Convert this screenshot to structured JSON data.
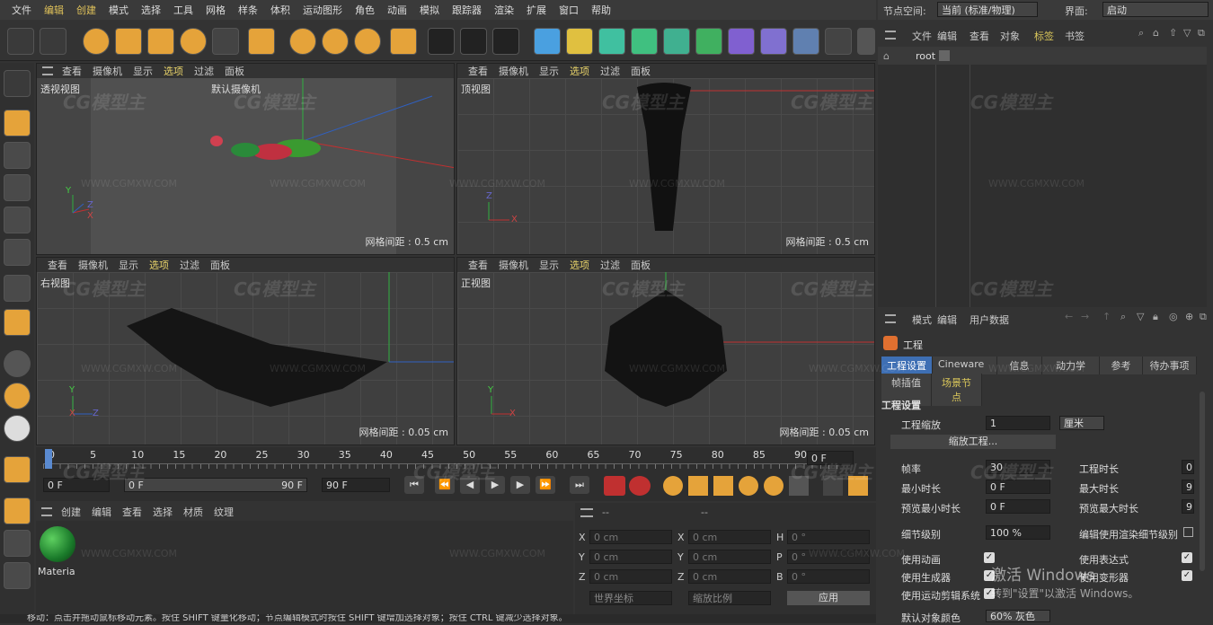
{
  "menubar": {
    "items": [
      "文件",
      "编辑",
      "创建",
      "模式",
      "选择",
      "工具",
      "网格",
      "样条",
      "体积",
      "运动图形",
      "角色",
      "动画",
      "模拟",
      "跟踪器",
      "渲染",
      "扩展",
      "窗口",
      "帮助"
    ]
  },
  "right_header": {
    "node_space_label": "节点空间:",
    "node_space_value": "当前 (标准/物理)",
    "interface_label": "界面:",
    "interface_value": "启动"
  },
  "viewport_menu": [
    "查看",
    "摄像机",
    "显示",
    "选项",
    "过滤",
    "面板"
  ],
  "viewports": {
    "perspective": {
      "name": "透视视图",
      "camera": "默认摄像机",
      "grid": "网格间距 : 0.5 cm"
    },
    "top": {
      "name": "顶视图",
      "grid": "网格间距 : 0.5 cm"
    },
    "right": {
      "name": "右视图",
      "grid": "网格间距 : 0.05 cm"
    },
    "front": {
      "name": "正视图",
      "grid": "网格间距 : 0.05 cm"
    }
  },
  "axes": {
    "x": "X",
    "y": "Y",
    "z": "Z"
  },
  "timeline": {
    "ticks": [
      "0",
      "5",
      "10",
      "15",
      "20",
      "25",
      "30",
      "35",
      "40",
      "45",
      "50",
      "55",
      "60",
      "65",
      "70",
      "75",
      "80",
      "85",
      "90"
    ],
    "current_frame": "0 F",
    "start_field": "0 F",
    "range_start": "0 F",
    "range_end": "90 F",
    "end_field": "90 F"
  },
  "material_panel": {
    "menu": [
      "创建",
      "编辑",
      "查看",
      "选择",
      "材质",
      "纹理"
    ],
    "material_name": "Materia"
  },
  "coord_panel": {
    "rows": [
      {
        "a": "X",
        "av": "0 cm",
        "b": "X",
        "bv": "0 cm",
        "c": "H",
        "cv": "0 °"
      },
      {
        "a": "Y",
        "av": "0 cm",
        "b": "Y",
        "bv": "0 cm",
        "c": "P",
        "cv": "0 °"
      },
      {
        "a": "Z",
        "av": "0 cm",
        "b": "Z",
        "bv": "0 cm",
        "c": "B",
        "cv": "0 °"
      }
    ],
    "dash1": "--",
    "dash2": "--",
    "world": "世界坐标",
    "scale": "缩放比例",
    "apply": "应用"
  },
  "object_manager": {
    "menu": [
      "文件",
      "编辑",
      "查看",
      "对象",
      "标签",
      "书签"
    ],
    "root": "root"
  },
  "attributes": {
    "menu": [
      "模式",
      "编辑",
      "用户数据"
    ],
    "title": "工程",
    "tabs_row1": [
      "工程设置",
      "Cineware",
      "信息",
      "动力学",
      "参考",
      "待办事项"
    ],
    "tabs_row2": [
      "帧插值",
      "场景节点"
    ],
    "section": "工程设置",
    "scale_label": "工程缩放",
    "scale_value": "1",
    "scale_unit": "厘米",
    "scale_button": "缩放工程...",
    "fps_label": "帧率",
    "fps_value": "30",
    "project_time_label": "工程时长",
    "project_time_value": "0",
    "min_time_label": "最小时长",
    "min_time_value": "0 F",
    "max_time_label": "最大时长",
    "max_time_value": "9",
    "preview_min_label": "预览最小时长",
    "preview_min_value": "0 F",
    "preview_max_label": "预览最大时长",
    "preview_max_value": "9",
    "lod_label": "细节级别",
    "lod_value": "100 %",
    "render_lod_label": "编辑使用渲染细节级别",
    "use_anim": "使用动画",
    "use_expr": "使用表达式",
    "use_gen": "使用生成器",
    "use_deform": "使用变形器",
    "use_mograph": "使用运动剪辑系统",
    "default_color_label": "默认对象颜色",
    "default_color_value": "60% 灰色",
    "activate_title": "激活 Windows",
    "activate_sub": "转到\"设置\"以激活 Windows。"
  },
  "watermark": {
    "logo": "CG模型主",
    "url": "WWW.CGMXW.COM"
  },
  "status": "移动：点击并拖动鼠标移动元素。按住 SHIFT 键量化移动；节点编辑模式时按住 SHIFT 键增加选择对象；按住 CTRL 键减少选择对象。"
}
